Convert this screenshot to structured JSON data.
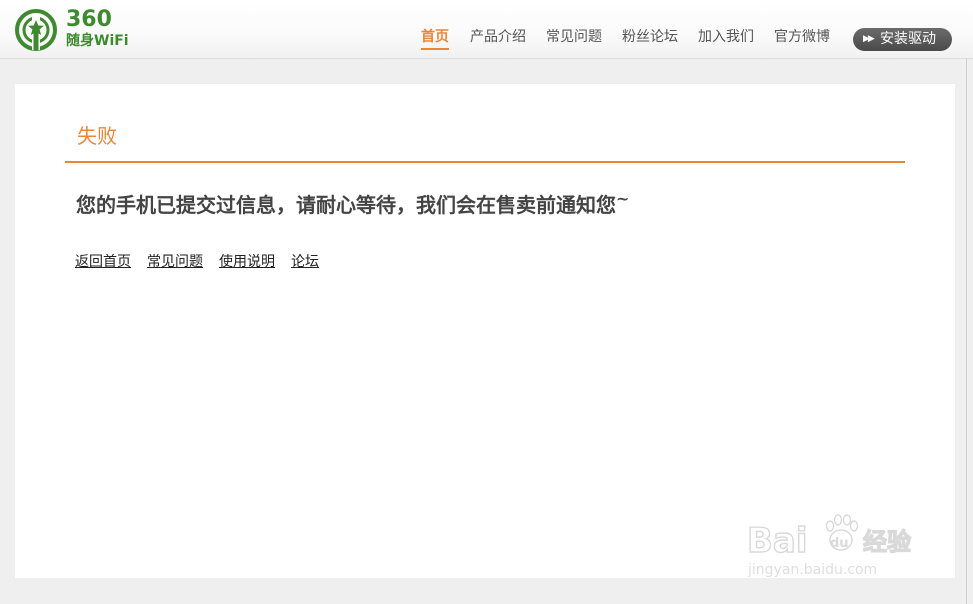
{
  "header": {
    "logo": {
      "number": "360",
      "subtitle": "随身WiFi",
      "icon": "wifi-signal-star-icon",
      "brand_color": "#3e8a2f"
    },
    "nav": [
      {
        "label": "首页",
        "active": true
      },
      {
        "label": "产品介绍",
        "active": false
      },
      {
        "label": "常见问题",
        "active": false
      },
      {
        "label": "粉丝论坛",
        "active": false
      },
      {
        "label": "加入我们",
        "active": false
      },
      {
        "label": "官方微博",
        "active": false
      }
    ],
    "install_button": {
      "label": "安装驱动",
      "icon": "double-chevron-right-icon"
    }
  },
  "content": {
    "title": "失败",
    "message": "您的手机已提交过信息，请耐心等待，我们会在售卖前通知您",
    "message_suffix": "~",
    "links": [
      "返回首页",
      "常见问题",
      "使用说明",
      "论坛"
    ]
  },
  "watermark": {
    "brand": "Bai",
    "brand_tail": "du",
    "cn": "经验",
    "url": "jingyan.baidu.com"
  },
  "colors": {
    "accent": "#e8873a",
    "text": "#444444",
    "page_bg": "#efefef",
    "panel_bg": "#ffffff",
    "button_bg": "#555555"
  }
}
